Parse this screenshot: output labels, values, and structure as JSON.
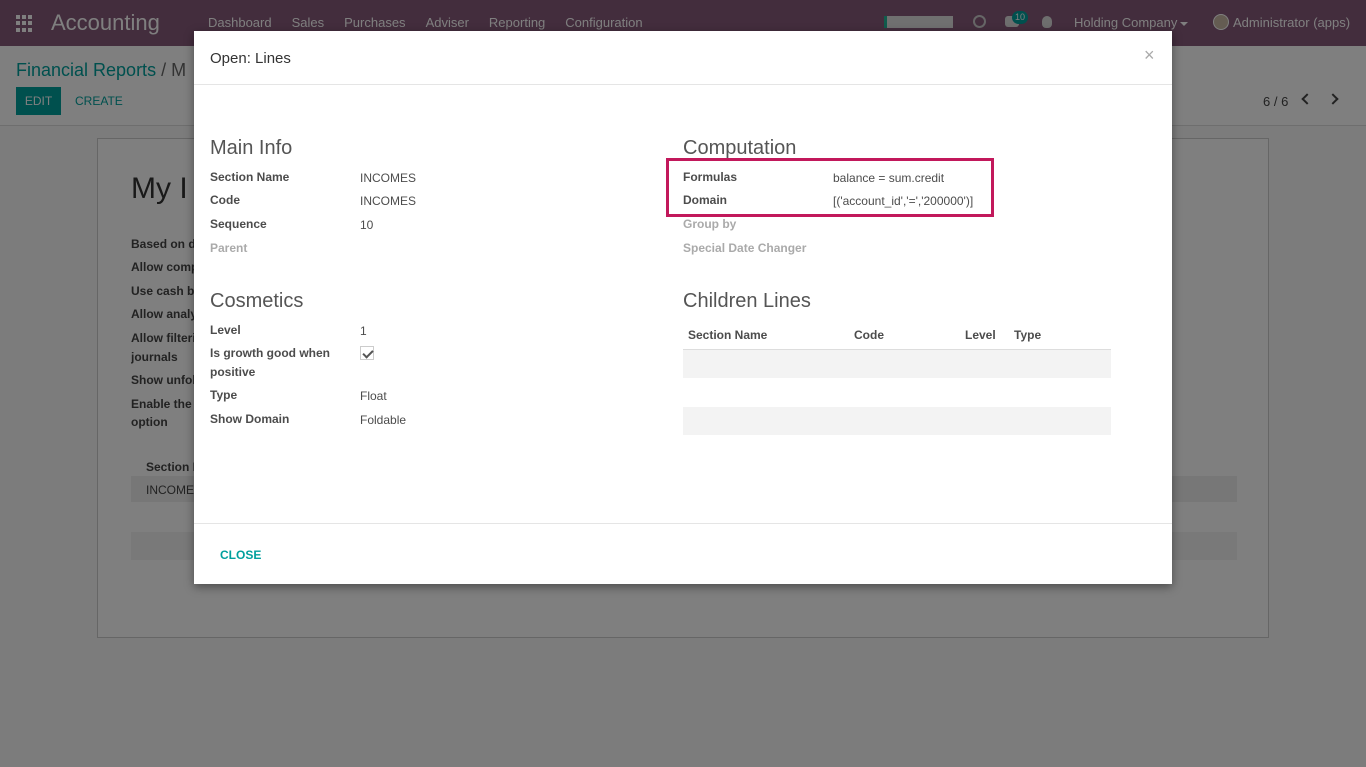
{
  "nav": {
    "app_title": "Accounting",
    "menu": [
      "Dashboard",
      "Sales",
      "Purchases",
      "Adviser",
      "Reporting",
      "Configuration"
    ],
    "notification_count": "10",
    "company": "Holding Company",
    "user": "Administrator (apps)",
    "progress_fraction": 0.05,
    "icons": [
      "apps-grid-icon",
      "clock-icon",
      "chat-icon",
      "bug-icon",
      "avatar"
    ]
  },
  "control_panel": {
    "breadcrumb_root": "Financial Reports",
    "breadcrumb_sep": "/",
    "breadcrumb_current": "M",
    "edit_label": "EDIT",
    "create_label": "CREATE",
    "pager": "6 / 6"
  },
  "sheet": {
    "title": "My I",
    "fields": [
      "Based on d",
      "Allow comp",
      "Use cash b",
      "Allow analy",
      "Allow filteri",
      "journals",
      "Show unfol",
      "Enable the",
      "option"
    ],
    "table_header": "Section N",
    "table_row": "INCOME"
  },
  "modal": {
    "title": "Open: Lines",
    "close_symbol": "×",
    "main_info": {
      "title": "Main Info",
      "section_name_label": "Section Name",
      "section_name": "INCOMES",
      "code_label": "Code",
      "code": "INCOMES",
      "sequence_label": "Sequence",
      "sequence": "10",
      "parent_label": "Parent"
    },
    "computation": {
      "title": "Computation",
      "formulas_label": "Formulas",
      "formulas": "balance = sum.credit",
      "domain_label": "Domain",
      "domain": "[('account_id','=','200000')]",
      "group_by_label": "Group by",
      "special_date_label": "Special Date Changer"
    },
    "cosmetics": {
      "title": "Cosmetics",
      "level_label": "Level",
      "level": "1",
      "growth_label_1": "Is growth good when",
      "growth_label_2": "positive",
      "growth_checked": true,
      "type_label": "Type",
      "type": "Float",
      "show_domain_label": "Show Domain",
      "show_domain": "Foldable"
    },
    "children": {
      "title": "Children Lines",
      "columns": [
        "Section Name",
        "Code",
        "Level",
        "Type"
      ]
    },
    "close_button": "CLOSE"
  },
  "colors": {
    "nav_bg": "#875a7b",
    "accent": "#00a09d",
    "highlight": "#c2185b"
  }
}
